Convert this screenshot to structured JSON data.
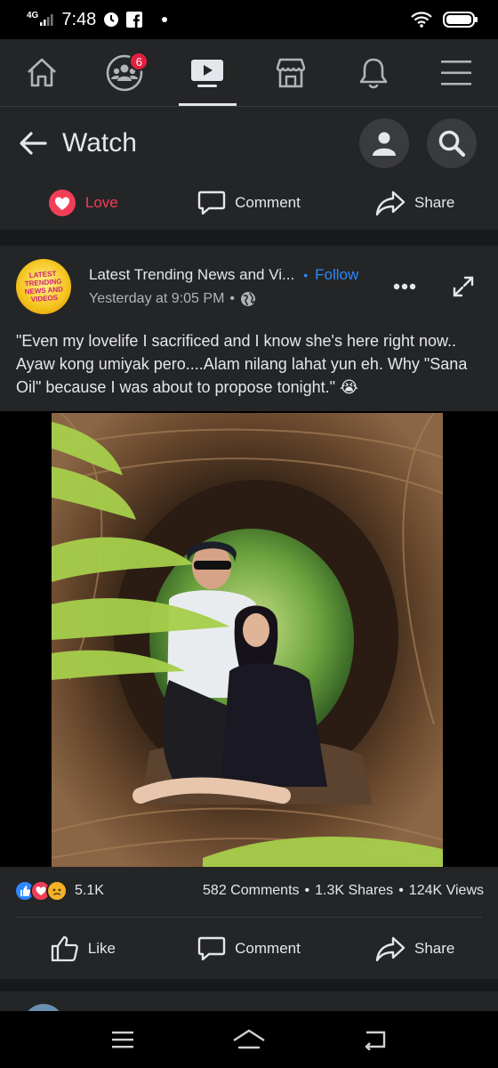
{
  "status_bar": {
    "network": "4G",
    "time": "7:48"
  },
  "nav": {
    "items": [
      {
        "name": "home"
      },
      {
        "name": "groups",
        "badge": "6"
      },
      {
        "name": "watch",
        "active": true
      },
      {
        "name": "marketplace"
      },
      {
        "name": "notifications"
      },
      {
        "name": "menu"
      }
    ]
  },
  "header": {
    "title": "Watch"
  },
  "prev_post_actions": {
    "love": "Love",
    "comment": "Comment",
    "share": "Share"
  },
  "post": {
    "avatar_text": "LATEST TRENDING NEWS AND VIDEOS",
    "page_name": "Latest Trending News and Vi...",
    "dot": "•",
    "follow": "Follow",
    "time": "Yesterday at 9:05 PM",
    "time_sep": "•",
    "caption": "\"Even my lovelife I sacrificed and I know she's here right now.. Ayaw kong umiyak pero....Alam nilang lahat yun eh. Why \"Sana Oil\" because I was about to propose tonight.\" 😭",
    "reaction_count": "5.1K",
    "comments": "582 Comments",
    "shares": "1.3K Shares",
    "views": "124K Views",
    "stats_sep": "•",
    "actions": {
      "like": "Like",
      "comment": "Comment",
      "share": "Share"
    }
  },
  "colors": {
    "accent": "#2d88ff",
    "love": "#f33e58",
    "badge": "#e41e3f",
    "surface": "#242526",
    "background": "#18191a"
  }
}
